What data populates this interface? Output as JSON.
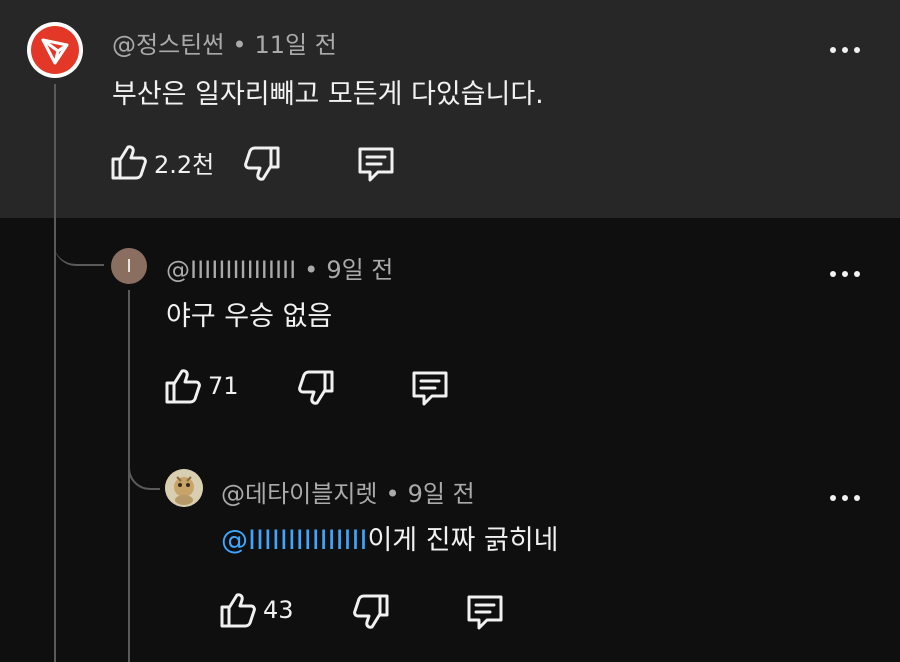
{
  "comments": [
    {
      "author": "@정스틴썬",
      "time": "11일 전",
      "text": "부산은 일자리빼고 모든게 다있습니다.",
      "likes": "2.2천"
    },
    {
      "author": "@IIIIIIIIIIIIIII",
      "avatar_letter": "I",
      "time": "9일 전",
      "text": "야구 우승 없음",
      "likes": "71"
    },
    {
      "author": "@데타이블지렛",
      "time": "9일 전",
      "mention": "@IIIIIIIIIIIIIII",
      "text": "이게 진짜 긁히네",
      "likes": "43"
    }
  ],
  "separator": "•",
  "icons": {
    "like": "thumbs-up-icon",
    "dislike": "thumbs-down-icon",
    "reply": "comment-icon",
    "more": "more-options-icon"
  },
  "colors": {
    "top_background": "#272727",
    "background": "#0f0f0f",
    "mention": "#3ea6ff",
    "avatar_red": "#e33728"
  }
}
